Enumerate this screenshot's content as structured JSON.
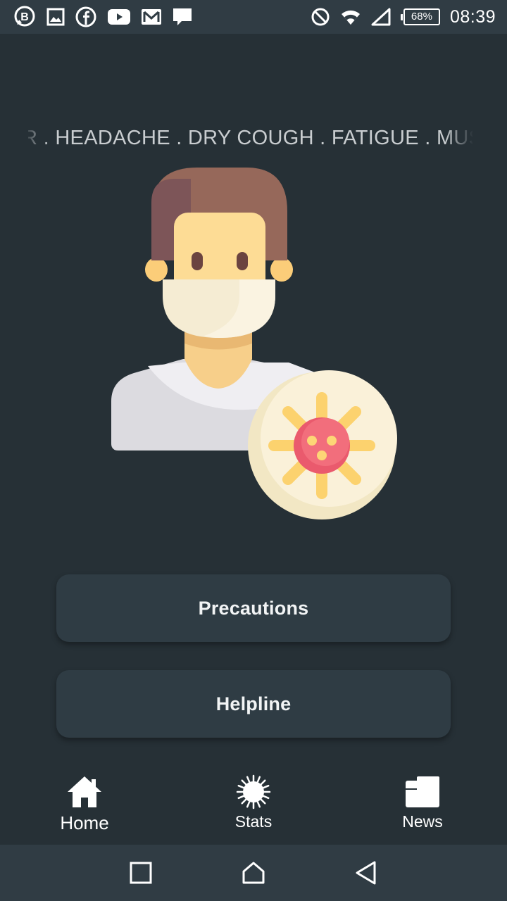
{
  "status_bar": {
    "icons": [
      "business-chat-icon",
      "gallery-icon",
      "facebook-icon",
      "youtube-icon",
      "gmail-icon",
      "message-icon"
    ],
    "system_icons": [
      "do-not-disturb-icon",
      "wifi-icon",
      "cell-signal-icon"
    ],
    "battery": "68%",
    "time": "08:39"
  },
  "symptoms_marquee": "R . HEADACHE . DRY COUGH . FATIGUE . MUSCL",
  "actions": {
    "precautions_label": "Precautions",
    "helpline_label": "Helpline"
  },
  "bottom_nav": {
    "items": [
      {
        "label": "Home",
        "icon": "home-icon",
        "active": true
      },
      {
        "label": "Stats",
        "icon": "virus-icon",
        "active": false
      },
      {
        "label": "News",
        "icon": "news-icon",
        "active": false
      }
    ]
  },
  "system_nav": [
    "recents-icon",
    "home-icon",
    "back-icon"
  ],
  "colors": {
    "background": "#263036",
    "button": "#2f3c44",
    "status_bar": "#303c44",
    "marquee_text": "#c9cdd0"
  }
}
